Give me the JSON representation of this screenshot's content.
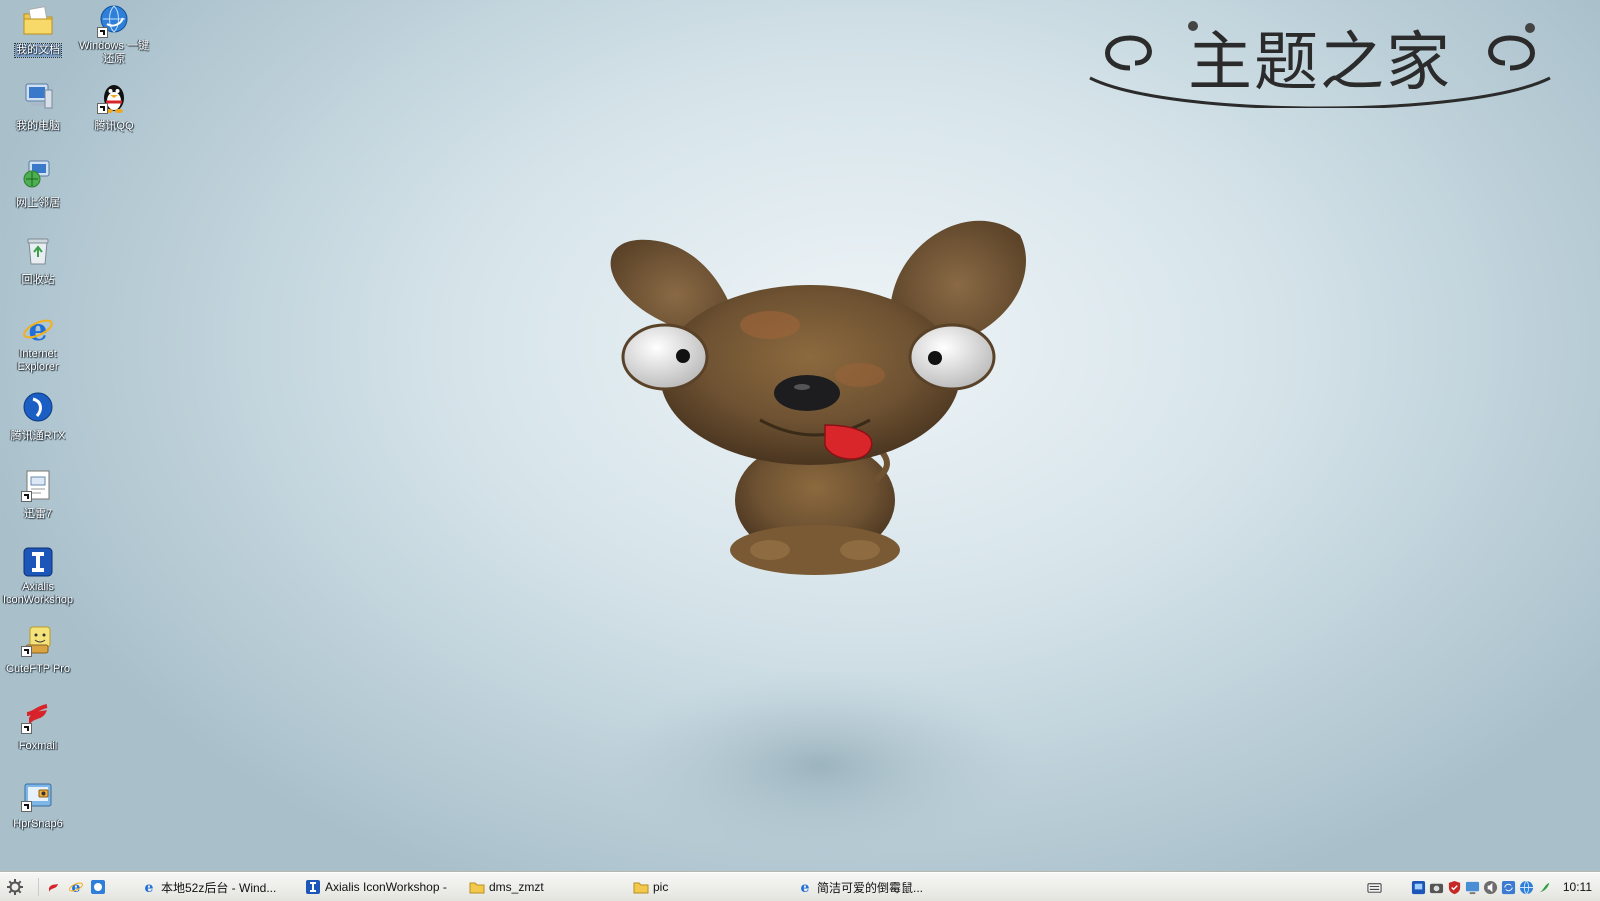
{
  "desktop": {
    "icons": [
      {
        "label": "我的文档",
        "icon": "folder-documents-icon"
      },
      {
        "label": "Windows 一键还原",
        "icon": "restore-globe-icon"
      },
      {
        "label": "我的电脑",
        "icon": "computer-icon"
      },
      {
        "label": "腾讯QQ",
        "icon": "qq-penguin-icon"
      },
      {
        "label": "网上邻居",
        "icon": "network-icon"
      },
      {
        "label": "回收站",
        "icon": "recycle-bin-icon"
      },
      {
        "label": "Internet Explorer",
        "icon": "ie-icon"
      },
      {
        "label": "腾讯通RTX",
        "icon": "rtx-icon"
      },
      {
        "label": "迅雷7",
        "icon": "thunder-icon"
      },
      {
        "label": "Axialis IconWorkshop",
        "icon": "iconworkshop-icon"
      },
      {
        "label": "CuteFTP Pro",
        "icon": "cuteftp-icon"
      },
      {
        "label": "Foxmail",
        "icon": "foxmail-icon"
      },
      {
        "label": "HprSnap6",
        "icon": "hprsnap-icon"
      }
    ]
  },
  "brand": {
    "text": "主题之家"
  },
  "taskbar": {
    "start_icon": "gear-icon",
    "quick_launch": [
      "foxmail-icon",
      "ie-icon",
      "browser-icon"
    ],
    "tasks": [
      {
        "label": "本地52z后台 - Wind...",
        "icon": "ie-icon"
      },
      {
        "label": "Axialis IconWorkshop -",
        "icon": "iconworkshop-icon"
      },
      {
        "label": "dms_zmzt",
        "icon": "folder-icon"
      },
      {
        "label": "pic",
        "icon": "folder-icon"
      },
      {
        "label": "简洁可爱的倒霉鼠...",
        "icon": "ie-icon"
      }
    ],
    "tray_icons": [
      "keyboard-icon",
      "network-icon",
      "camera-icon",
      "shield-icon",
      "monitor-icon",
      "speaker-icon",
      "sync-icon",
      "globe-icon",
      "rtx-icon"
    ],
    "clock": "10:11"
  },
  "colors": {
    "ie_blue": "#1f6fd6",
    "folder_yellow": "#f2c94c",
    "taskbar_bg": "#ecece8"
  }
}
